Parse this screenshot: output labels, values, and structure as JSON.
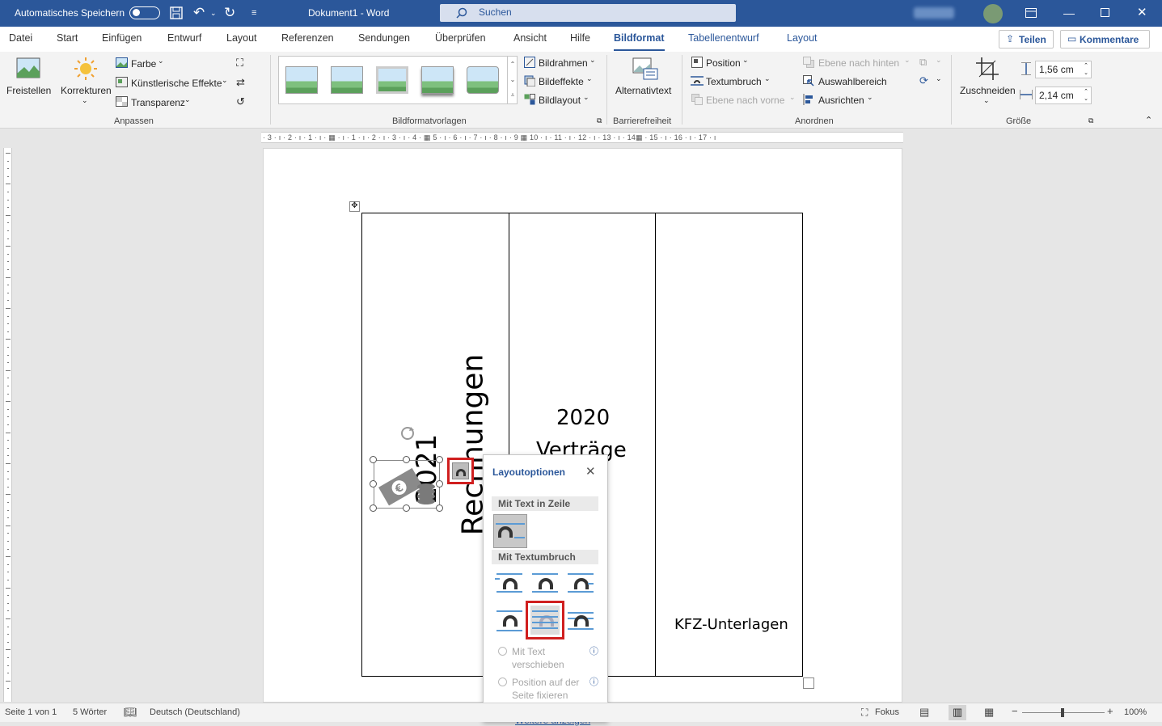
{
  "titlebar": {
    "autosave_label": "Automatisches Speichern",
    "doc_title": "Dokument1  -  Word",
    "search_placeholder": "Suchen",
    "accent": "#2b579a"
  },
  "tabs": [
    "Datei",
    "Start",
    "Einfügen",
    "Entwurf",
    "Layout",
    "Referenzen",
    "Sendungen",
    "Überprüfen",
    "Ansicht",
    "Hilfe",
    "Bildformat",
    "Tabellenentwurf",
    "Layout"
  ],
  "share": {
    "share_label": "Teilen",
    "comments_label": "Kommentare"
  },
  "ribbon": {
    "freistellen": "Freistellen",
    "korrekturen": "Korrekturen",
    "farbe": "Farbe",
    "kuenstlerisch": "Künstlerische Effekte",
    "transparenz": "Transparenz",
    "group_anpassen": "Anpassen",
    "bildrahmen": "Bildrahmen",
    "bildeffekte": "Bildeffekte",
    "bildlayout": "Bildlayout",
    "group_bildformat": "Bildformatvorlagen",
    "alternativtext": "Alternativtext",
    "group_barriere": "Barrierefreiheit",
    "position": "Position",
    "textumbruch": "Textumbruch",
    "ebene_vorne": "Ebene nach vorne",
    "ebene_hinten": "Ebene nach hinten",
    "auswahlbereich": "Auswahlbereich",
    "ausrichten": "Ausrichten",
    "group_anordnen": "Anordnen",
    "zuschneiden": "Zuschneiden",
    "height": "1,56 cm",
    "width": "2,14 cm",
    "group_groesse": "Größe"
  },
  "ruler": "· 3 · ı · 2 · ı · 1 · ı ·  ▦ · ı · 1 · ı · 2 · ı · 3 · ı · 4 · ▦ 5 · ı · 6 · ı · 7 · ı · 8 · ı · 9 ▦ 10 · ı · 11 · ı · 12 · ı · 13 · ı · 14▦ · 15 · ı · 16 · ı · 17 · ı",
  "document": {
    "rotated_text": "Rechnungen",
    "rotated_year": "2021",
    "col2_year": "2020",
    "col2_text": "Verträge",
    "col3_text": "KFZ-Unterlagen"
  },
  "popup": {
    "title": "Layoutoptionen",
    "section_inline": "Mit Text in Zeile",
    "section_wrap": "Mit Textumbruch",
    "move_with_text": "Mit Text verschieben",
    "fix_position": "Position auf der Seite fixieren",
    "more": "Weitere anzeigen"
  },
  "status": {
    "page": "Seite 1 von 1",
    "words": "5 Wörter",
    "language": "Deutsch (Deutschland)",
    "focus": "Fokus",
    "zoom": "100%"
  }
}
